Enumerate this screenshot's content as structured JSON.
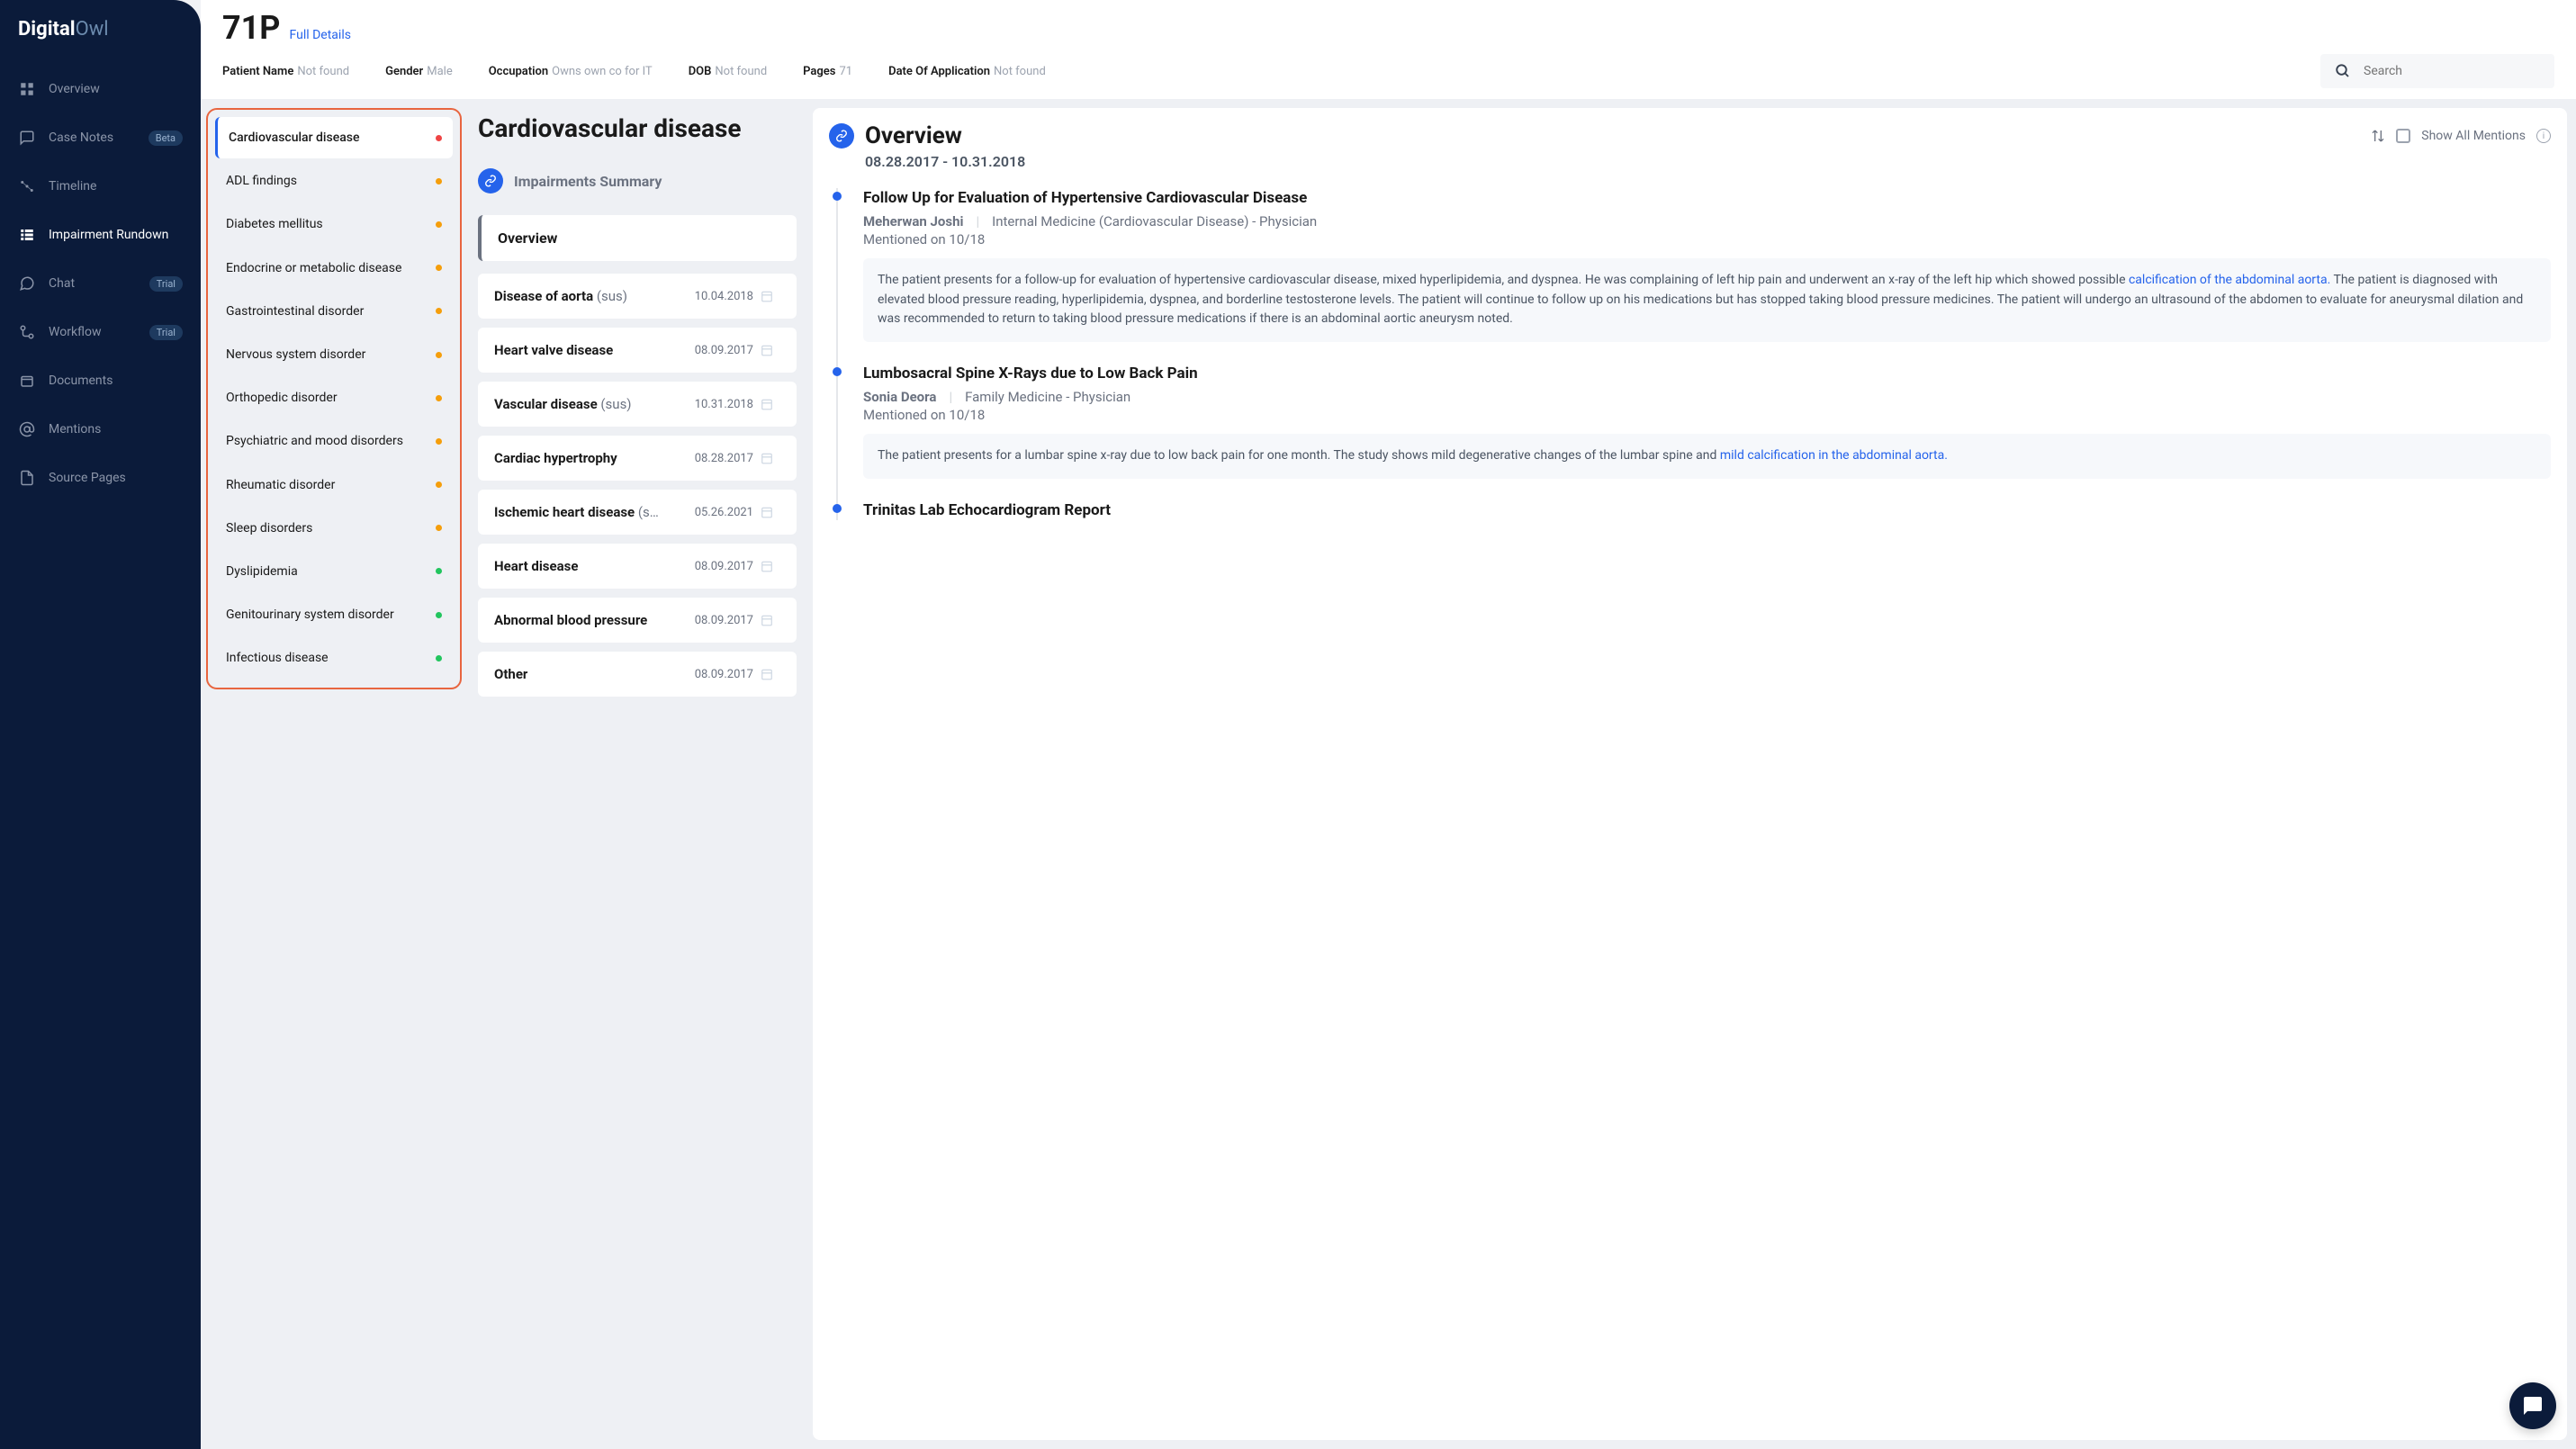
{
  "brand": {
    "a": "Digital",
    "b": "Owl"
  },
  "nav": [
    {
      "label": "Overview",
      "icon": "grid"
    },
    {
      "label": "Case Notes",
      "icon": "notes",
      "badge": "Beta"
    },
    {
      "label": "Timeline",
      "icon": "timeline"
    },
    {
      "label": "Impairment Rundown",
      "icon": "rundown",
      "active": true
    },
    {
      "label": "Chat",
      "icon": "chat",
      "badge": "Trial"
    },
    {
      "label": "Workflow",
      "icon": "workflow",
      "badge": "Trial"
    },
    {
      "label": "Documents",
      "icon": "docs"
    },
    {
      "label": "Mentions",
      "icon": "mentions"
    },
    {
      "label": "Source Pages",
      "icon": "pages"
    }
  ],
  "header": {
    "patient_id": "71P",
    "full_details": "Full Details",
    "meta": [
      {
        "label": "Patient Name",
        "value": "Not found"
      },
      {
        "label": "Gender",
        "value": "Male"
      },
      {
        "label": "Occupation",
        "value": "Owns own co for IT"
      },
      {
        "label": "DOB",
        "value": "Not found"
      },
      {
        "label": "Pages",
        "value": "71"
      },
      {
        "label": "Date Of Application",
        "value": "Not found"
      }
    ],
    "search_placeholder": "Search"
  },
  "impairments": [
    {
      "label": "Cardiovascular disease",
      "dot": "red",
      "selected": true
    },
    {
      "label": "ADL findings",
      "dot": "orange"
    },
    {
      "label": "Diabetes mellitus",
      "dot": "orange"
    },
    {
      "label": "Endocrine or metabolic disease",
      "dot": "orange"
    },
    {
      "label": "Gastrointestinal disorder",
      "dot": "orange"
    },
    {
      "label": "Nervous system disorder",
      "dot": "orange"
    },
    {
      "label": "Orthopedic disorder",
      "dot": "orange"
    },
    {
      "label": "Psychiatric and mood disorders",
      "dot": "orange"
    },
    {
      "label": "Rheumatic disorder",
      "dot": "orange"
    },
    {
      "label": "Sleep disorders",
      "dot": "orange"
    },
    {
      "label": "Dyslipidemia",
      "dot": "green"
    },
    {
      "label": "Genitourinary system disorder",
      "dot": "green"
    },
    {
      "label": "Infectious disease",
      "dot": "green"
    }
  ],
  "summary": {
    "title": "Cardiovascular disease",
    "section": "Impairments Summary",
    "overview": "Overview",
    "conditions": [
      {
        "name": "Disease of aorta",
        "sus": "(sus)",
        "date": "10.04.2018",
        "dot": "red"
      },
      {
        "name": "Heart valve disease",
        "sus": "",
        "date": "08.09.2017",
        "dot": "red"
      },
      {
        "name": "Vascular disease",
        "sus": "(sus)",
        "date": "10.31.2018",
        "dot": "red"
      },
      {
        "name": "Cardiac hypertrophy",
        "sus": "",
        "date": "08.28.2017",
        "dot": "orange"
      },
      {
        "name": "Ischemic heart disease",
        "sus": "(s…",
        "date": "05.26.2021",
        "dot": "orange"
      },
      {
        "name": "Heart disease",
        "sus": "",
        "date": "08.09.2017",
        "dot": "orange"
      },
      {
        "name": "Abnormal blood pressure",
        "sus": "",
        "date": "08.09.2017",
        "dot": "green"
      },
      {
        "name": "Other",
        "sus": "",
        "date": "08.09.2017",
        "dot": "orange"
      }
    ]
  },
  "overview": {
    "title": "Overview",
    "show_all": "Show All Mentions",
    "range": "08.28.2017 - 10.31.2018",
    "events": [
      {
        "title": "Follow Up for Evaluation of Hypertensive Cardiovascular Disease",
        "doctor": "Meherwan Joshi",
        "spec": "Internal Medicine (Cardiovascular Disease) - Physician",
        "mentioned": "Mentioned on 10/18",
        "note_pre": "The patient presents for a follow-up for evaluation of hypertensive cardiovascular disease, mixed hyperlipidemia, and dyspnea. He was complaining of left hip pain and underwent an x-ray of the left hip which showed possible ",
        "note_hl": "calcification of the abdominal aorta.",
        "note_post": " The patient is diagnosed with elevated blood pressure reading, hyperlipidemia, dyspnea, and borderline testosterone levels. The patient will continue to follow up on his medications but has stopped taking blood pressure medicines. The patient will undergo an ultrasound of the abdomen to evaluate for aneurysmal dilation and was recommended to return to taking blood pressure medications if there is an abdominal aortic aneurysm noted."
      },
      {
        "title": "Lumbosacral Spine X-Rays due to Low Back Pain",
        "doctor": "Sonia Deora",
        "spec": "Family Medicine - Physician",
        "mentioned": "Mentioned on 10/18",
        "note_pre": "The patient presents for a lumbar spine x-ray due to low back pain for one month. The study shows mild degenerative changes of the lumbar spine and ",
        "note_hl": "mild calcification in the abdominal aorta.",
        "note_post": ""
      },
      {
        "title": "Trinitas Lab Echocardiogram Report",
        "doctor": "",
        "spec": "",
        "mentioned": "",
        "note_pre": "",
        "note_hl": "",
        "note_post": ""
      }
    ]
  }
}
